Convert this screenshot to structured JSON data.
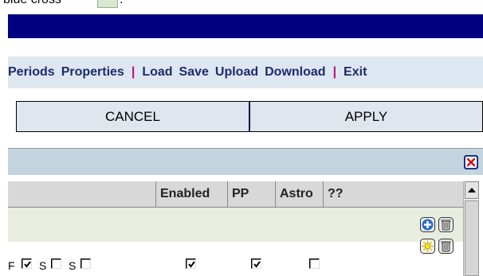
{
  "caption": {
    "text_before": "blue cross",
    "text_after": "."
  },
  "menu": {
    "items": [
      "Periods",
      "Properties",
      "|",
      "Load",
      "Save",
      "Upload",
      "Download",
      "|",
      "Exit"
    ]
  },
  "buttons": {
    "cancel": "CANCEL",
    "apply": "APPLY"
  },
  "table": {
    "headers": [
      "",
      "Enabled",
      "PP",
      "Astro",
      "??"
    ]
  },
  "row": {
    "label_f": "F",
    "label_s1": "S",
    "label_s2": "S",
    "f_checked": true,
    "s1_checked": false,
    "s2_checked": false,
    "enabled_checked": true,
    "pp_checked": true,
    "astro_checked": false
  },
  "colors": {
    "navy": "#000080",
    "menu_bg": "#dde7f1",
    "menu_text": "#1f2a6a",
    "separator": "#c01070"
  },
  "icons": [
    "close-icon",
    "add-icon",
    "trash-icon",
    "sun-icon",
    "scroll-up-arrow-icon"
  ]
}
